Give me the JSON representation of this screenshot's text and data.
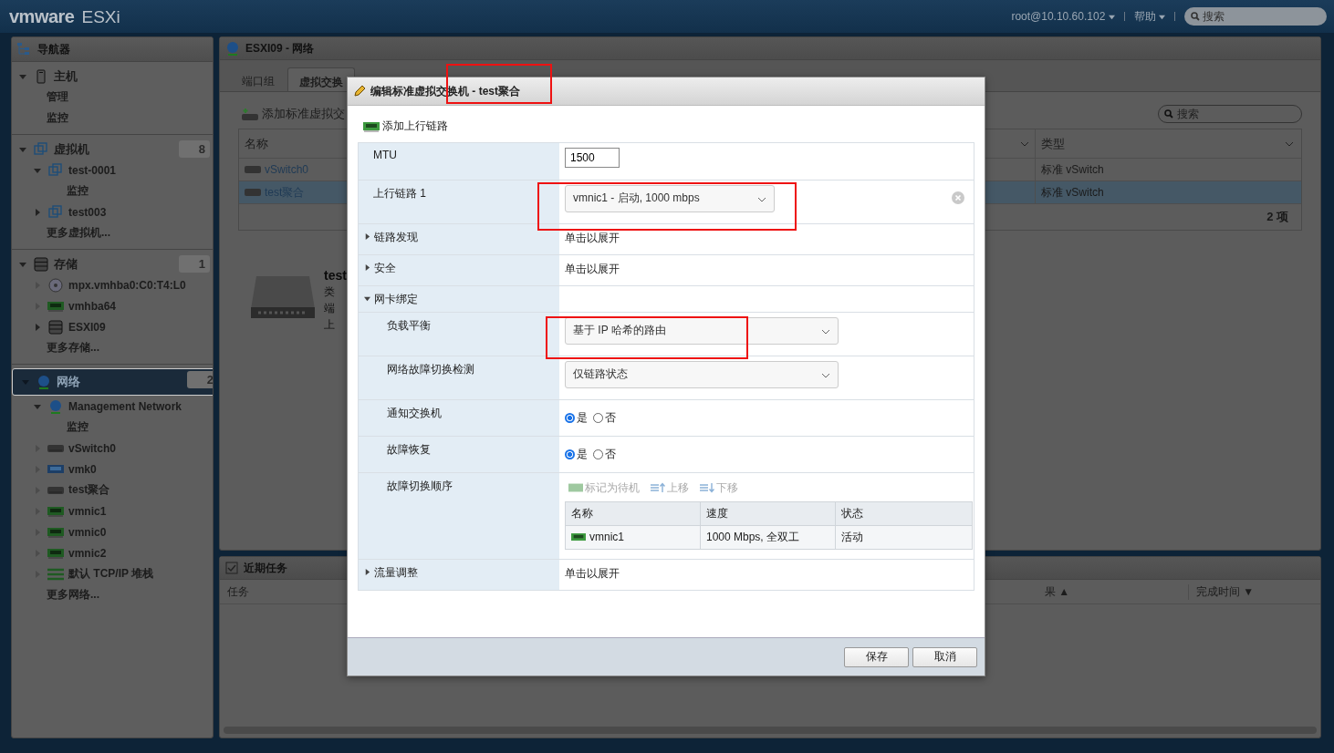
{
  "header": {
    "logo": "vmware",
    "product": "ESXi",
    "user": "root@10.10.60.102",
    "help": "帮助",
    "search": {
      "placeholder": "搜索"
    }
  },
  "navigator": {
    "title": "导航器",
    "sections": [
      {
        "label": "主机",
        "kind": "host",
        "expanded": true,
        "selected": false,
        "children": [
          {
            "label": "管理"
          },
          {
            "label": "监控"
          }
        ]
      },
      {
        "label": "虚拟机",
        "kind": "vm",
        "expanded": true,
        "selected": false,
        "count": "8",
        "children": [
          {
            "label": "test-0001",
            "kind": "vm",
            "expanded": true,
            "disabled": false,
            "children": [
              {
                "label": "监控"
              }
            ]
          },
          {
            "label": "test003",
            "kind": "vm",
            "expanded": false,
            "disabled": false
          },
          {
            "label": "更多虚拟机..."
          }
        ]
      },
      {
        "label": "存储",
        "kind": "storage",
        "expanded": true,
        "selected": false,
        "count": "1",
        "children": [
          {
            "label": "mpx.vmhba0:C0:T4:L0",
            "kind": "disc",
            "expanded": false,
            "disabled": true
          },
          {
            "label": "vmhba64",
            "kind": "nic",
            "expanded": false,
            "disabled": true
          },
          {
            "label": "ESXI09",
            "kind": "storage",
            "expanded": false,
            "disabled": false
          },
          {
            "label": "更多存储..."
          }
        ]
      },
      {
        "label": "网络",
        "kind": "network",
        "expanded": true,
        "selected": true,
        "count": "2",
        "children": [
          {
            "label": "Management Network",
            "kind": "network",
            "expanded": true,
            "disabled": false,
            "children": [
              {
                "label": "监控"
              }
            ]
          },
          {
            "label": "vSwitch0",
            "kind": "switch",
            "expanded": false,
            "disabled": true
          },
          {
            "label": "vmk0",
            "kind": "vmk",
            "expanded": false,
            "disabled": true
          },
          {
            "label": "test聚合",
            "kind": "switch",
            "expanded": false,
            "disabled": true
          },
          {
            "label": "vmnic1",
            "kind": "nic",
            "expanded": false,
            "disabled": true
          },
          {
            "label": "vmnic0",
            "kind": "nic",
            "expanded": false,
            "disabled": true
          },
          {
            "label": "vmnic2",
            "kind": "nic",
            "expanded": false,
            "disabled": true
          },
          {
            "label": "默认 TCP/IP 堆栈",
            "kind": "stack",
            "expanded": false,
            "disabled": true
          },
          {
            "label": "更多网络..."
          }
        ]
      }
    ]
  },
  "main": {
    "title": "ESXI09 - 网络",
    "tabs": [
      {
        "label": "端口组",
        "selected": false
      },
      {
        "label": "虚拟交换",
        "selected": true
      }
    ],
    "action": "添加标准虚拟交",
    "search": {
      "placeholder": "搜索"
    },
    "table": {
      "columns": [
        "名称",
        "类型"
      ],
      "rows": [
        {
          "name": "vSwitch0",
          "type": "标准 vSwitch",
          "selected": false
        },
        {
          "name": "test聚合",
          "type": "标准 vSwitch",
          "selected": true
        }
      ],
      "footer": "2 项"
    },
    "detail": {
      "title": "test",
      "fields": [
        "类",
        "端",
        "上"
      ]
    }
  },
  "tasks": {
    "title": "近期任务",
    "columns": [
      "任务",
      "果 ▲",
      "完成时间 ▼"
    ]
  },
  "dialog": {
    "title": "编辑标准虚拟交换机 - test聚合",
    "title_highlighted": true,
    "action": "添加上行链路",
    "rows": [
      {
        "kind": "input",
        "label": "MTU",
        "value": "1500"
      },
      {
        "kind": "select",
        "label": "上行链路 1",
        "value": "vmnic1 - 启动, 1000 mbps",
        "removable": true,
        "highlighted": true
      },
      {
        "kind": "section",
        "label": "链路发现",
        "expanded": false,
        "value": "单击以展开"
      },
      {
        "kind": "section",
        "label": "安全",
        "expanded": false,
        "value": "单击以展开"
      },
      {
        "kind": "section",
        "label": "网卡绑定",
        "expanded": true
      },
      {
        "kind": "select",
        "label": "负载平衡",
        "value": "基于 IP 哈希的路由",
        "wide": true,
        "highlighted": true
      },
      {
        "kind": "select",
        "label": "网络故障切换检测",
        "value": "仅链路状态",
        "wide": true
      },
      {
        "kind": "radio",
        "label": "通知交换机",
        "options": [
          {
            "label": "是",
            "selected": true
          },
          {
            "label": "否",
            "selected": false
          }
        ]
      },
      {
        "kind": "radio",
        "label": "故障恢复",
        "options": [
          {
            "label": "是",
            "selected": true
          },
          {
            "label": "否",
            "selected": false
          }
        ]
      },
      {
        "kind": "order",
        "label": "故障切换顺序",
        "tools": [
          {
            "label": "标记为待机",
            "kind": "standby",
            "disabled": true
          },
          {
            "label": "上移",
            "kind": "up",
            "disabled": true
          },
          {
            "label": "下移",
            "kind": "down",
            "disabled": true
          }
        ],
        "columns": [
          "名称",
          "速度",
          "状态"
        ],
        "rows": [
          {
            "name": "vmnic1",
            "speed": "1000 Mbps, 全双工",
            "status": "活动"
          }
        ]
      },
      {
        "kind": "section",
        "label": "流量调整",
        "expanded": false,
        "value": "单击以展开"
      }
    ],
    "buttons": [
      "保存",
      "取消"
    ]
  }
}
